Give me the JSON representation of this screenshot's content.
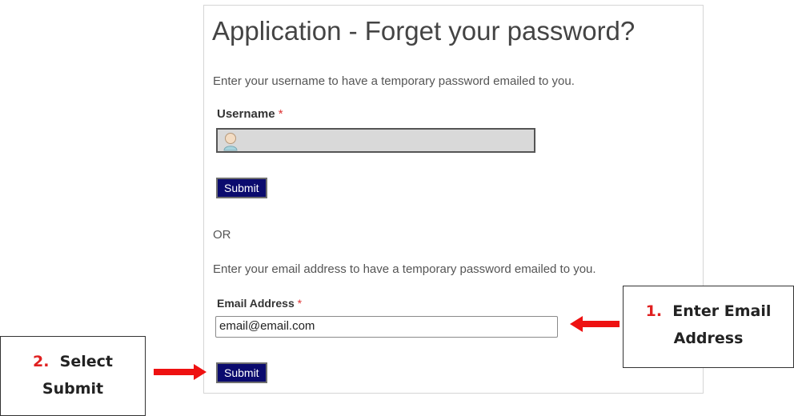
{
  "page": {
    "title": "Application - Forget your password?"
  },
  "username_section": {
    "instruction": "Enter your username to have a temporary password emailed to you.",
    "label": "Username",
    "required_marker": "*",
    "value": "",
    "submit_label": "Submit"
  },
  "separator": {
    "text": "OR"
  },
  "email_section": {
    "instruction": "Enter your email address to have a temporary password emailed to you.",
    "label": "Email Address",
    "required_marker": "*",
    "value": "email@email.com",
    "submit_label": "Submit"
  },
  "callouts": {
    "step1": {
      "number": "1.",
      "line1": "Enter Email",
      "line2": "Address"
    },
    "step2": {
      "number": "2.",
      "line1": "Select",
      "line2": "Submit"
    }
  },
  "colors": {
    "button_bg": "#0b0b6e",
    "required": "#dd3333",
    "callout_number": "#e02020",
    "arrow": "#ee1111"
  },
  "icons": {
    "username_field_icon": "user-icon",
    "callout_arrow": "arrow-icon"
  }
}
